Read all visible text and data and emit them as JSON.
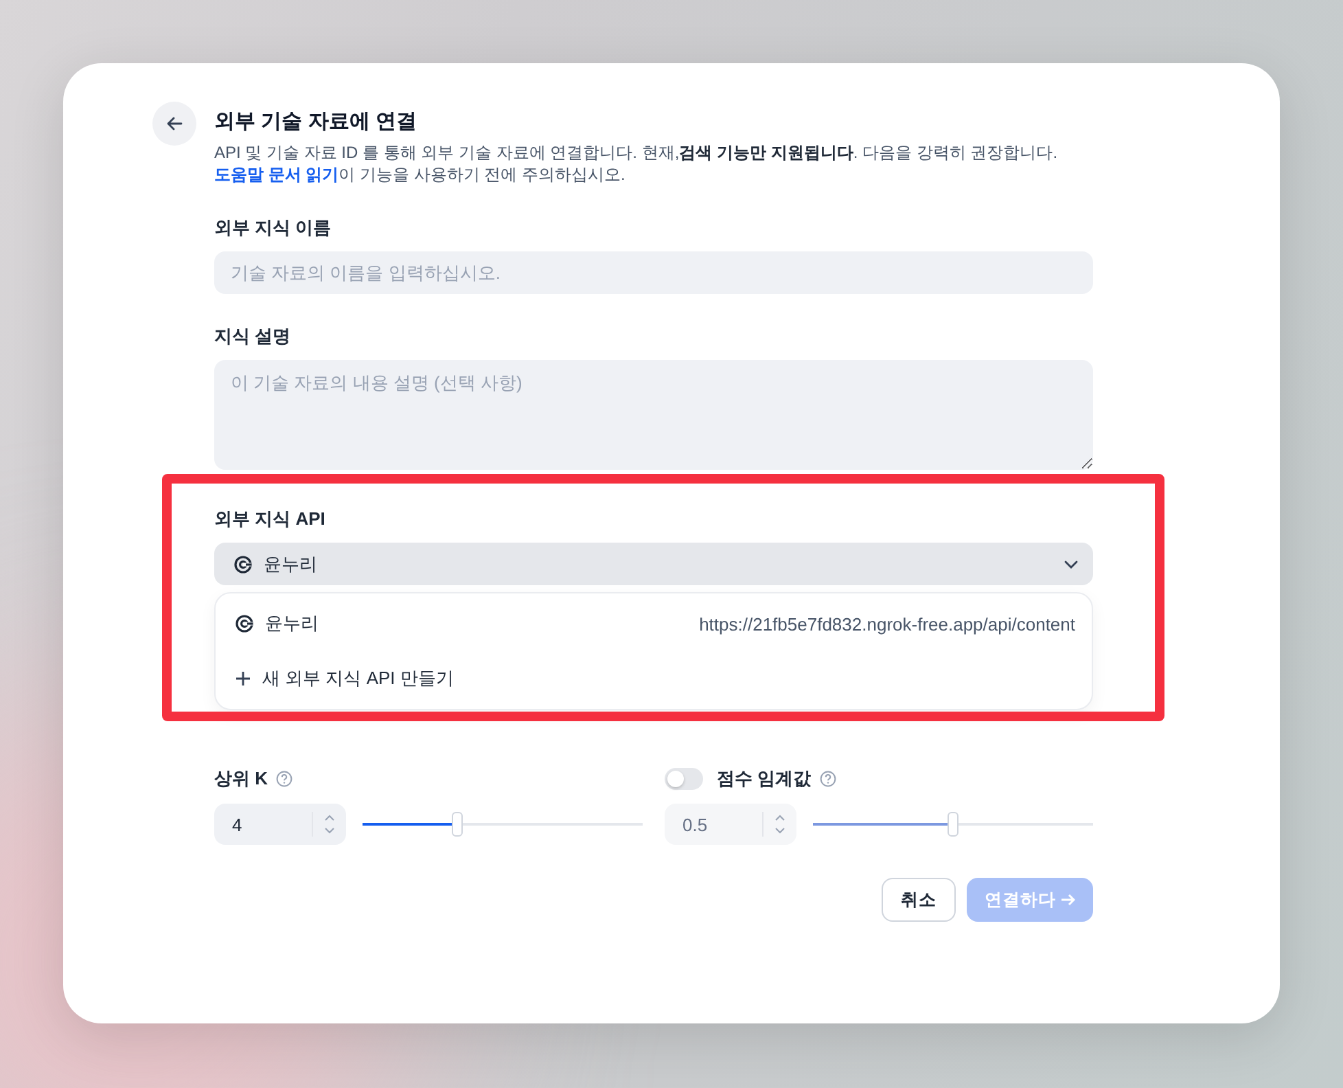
{
  "dialog": {
    "title": "외부 기술 자료에 연결",
    "description": "API 및 기술 자료 ID 를 통해 외부 기술 자료에 연결합니다. 현재,**검색 기능만 지원됩니다**. 다음을 강력히 권장합니다.",
    "help_link": "도움말 문서 읽기",
    "description_end": "이 기능을 사용하기 전에 주의하십시오."
  },
  "fields": [
    {
      "kind": "input",
      "label": "외부 지식 이름",
      "placeholder": "기술 자료의 이름을 입력하십시오."
    },
    {
      "kind": "textarea",
      "label": "지식 설명",
      "placeholder": "이 기술 자료의 내용 설명 (선택 사항)"
    }
  ],
  "api": {
    "label": "외부 지식 API",
    "value": "윤누리",
    "expanded": true,
    "options": [
      {
        "kind": "api",
        "name": "윤누리",
        "url": "https://21fb5e7fd832.ngrok-free.app/api/content"
      },
      {
        "kind": "create",
        "name": "새 외부 지식 API 만들기"
      }
    ]
  },
  "settings": [
    {
      "label": "상위 K",
      "value": "4",
      "level": 0.34,
      "disabled": false
    },
    {
      "label": "점수 임계값",
      "toggle": false,
      "value": "0.5",
      "level": 0.5,
      "disabled": true
    }
  ],
  "buttons": [
    {
      "kind": "secondary",
      "label": "취소"
    },
    {
      "kind": "primary",
      "label": "연결하다",
      "disabled": true
    }
  ]
}
